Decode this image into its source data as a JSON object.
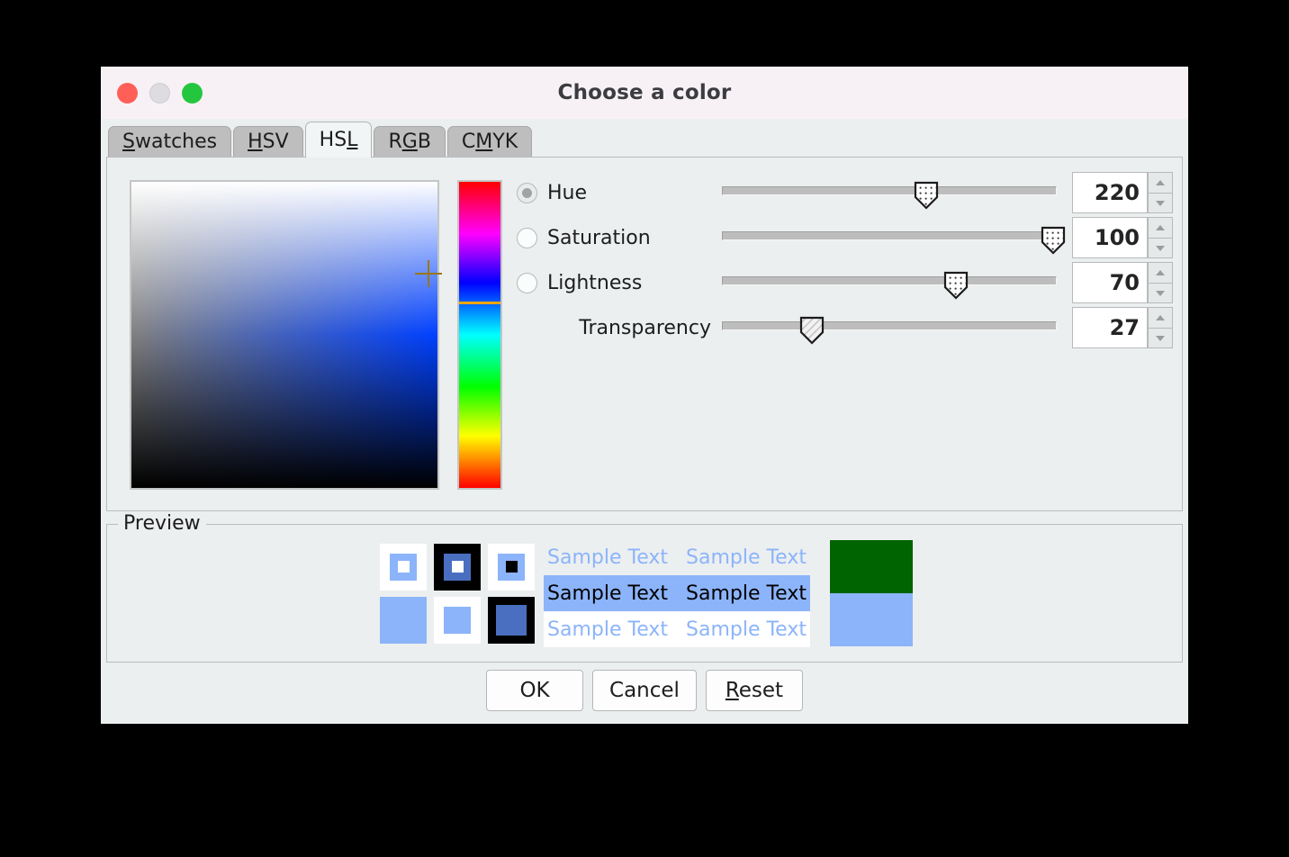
{
  "window": {
    "title": "Choose a color",
    "titlebar_bg": "#f7f1f5",
    "dialog_bg": "#eceff0",
    "traffic_lights": [
      {
        "name": "close",
        "color": "#ff5f57"
      },
      {
        "name": "minimize",
        "color": "#dedce0"
      },
      {
        "name": "maximize",
        "color": "#25c63f"
      }
    ]
  },
  "tabs": [
    {
      "id": "swatches",
      "pre": "",
      "mnemonic": "S",
      "post": "watches",
      "selected": false
    },
    {
      "id": "hsv",
      "pre": "",
      "mnemonic": "H",
      "post": "SV",
      "selected": false
    },
    {
      "id": "hsl",
      "pre": "HS",
      "mnemonic": "L",
      "post": "",
      "selected": true
    },
    {
      "id": "rgb",
      "pre": "R",
      "mnemonic": "G",
      "post": "B",
      "selected": false
    },
    {
      "id": "cmyk",
      "pre": "C",
      "mnemonic": "M",
      "post": "YK",
      "selected": false
    }
  ],
  "picker": {
    "gradient": {
      "base_hue_color": "#0040ff",
      "cursor_x_pct": 97,
      "cursor_y_pct": 30
    },
    "hue_strip": {
      "marker_pct": 39,
      "marker_color": "#ffa500"
    }
  },
  "controls": [
    {
      "id": "hue",
      "label": "Hue",
      "has_radio": true,
      "radio_checked": true,
      "value": "220",
      "thumb_pct": 61,
      "thumb_style": "dotted"
    },
    {
      "id": "saturation",
      "label": "Saturation",
      "has_radio": true,
      "radio_checked": false,
      "value": "100",
      "thumb_pct": 99,
      "thumb_style": "dotted"
    },
    {
      "id": "lightness",
      "label": "Lightness",
      "has_radio": true,
      "radio_checked": false,
      "value": "70",
      "thumb_pct": 70,
      "thumb_style": "dotted"
    },
    {
      "id": "transparency",
      "label": "Transparency",
      "has_radio": false,
      "radio_checked": false,
      "value": "27",
      "thumb_pct": 27,
      "thumb_style": "hatched"
    }
  ],
  "preview": {
    "legend": "Preview",
    "selected_color": "#8cb4fa",
    "swatches": [
      {
        "outer": "#ffffff",
        "mid": "#8cb4fa",
        "inner": "#ffffff"
      },
      {
        "outer": "#000000",
        "mid": "#4a6fc0",
        "inner": "#ffffff"
      },
      {
        "outer": "#ffffff",
        "mid": "#8cb4fa",
        "inner": "#000000"
      },
      {
        "outer": "#8cb4fa",
        "mid": "#8cb4fa",
        "inner": "#8cb4fa"
      },
      {
        "outer": "#ffffff",
        "mid": "#8cb4fa",
        "inner": "#8cb4fa"
      },
      {
        "outer": "#000000",
        "mid": "#4a6fc0",
        "inner": "#4a6fc0"
      }
    ],
    "sample_rows": [
      {
        "text_a": "Sample Text",
        "text_b": "Sample Text",
        "bg": "#eceff0",
        "fg": "#8cb4fa",
        "bold": false
      },
      {
        "text_a": "Sample Text",
        "text_b": "Sample Text",
        "bg": "#8cb4fa",
        "fg": "#000000",
        "bold": false
      },
      {
        "text_a": "Sample Text",
        "text_b": "Sample Text",
        "bg": "#ffffff",
        "fg": "#8cb4fa",
        "bold": false
      }
    ],
    "color_block": {
      "top": "#006400",
      "bottom": "#8cb4fa"
    }
  },
  "buttons": [
    {
      "id": "ok",
      "pre": "OK",
      "mnemonic": "",
      "post": ""
    },
    {
      "id": "cancel",
      "pre": "Cancel",
      "mnemonic": "",
      "post": ""
    },
    {
      "id": "reset",
      "pre": "",
      "mnemonic": "R",
      "post": "eset"
    }
  ]
}
